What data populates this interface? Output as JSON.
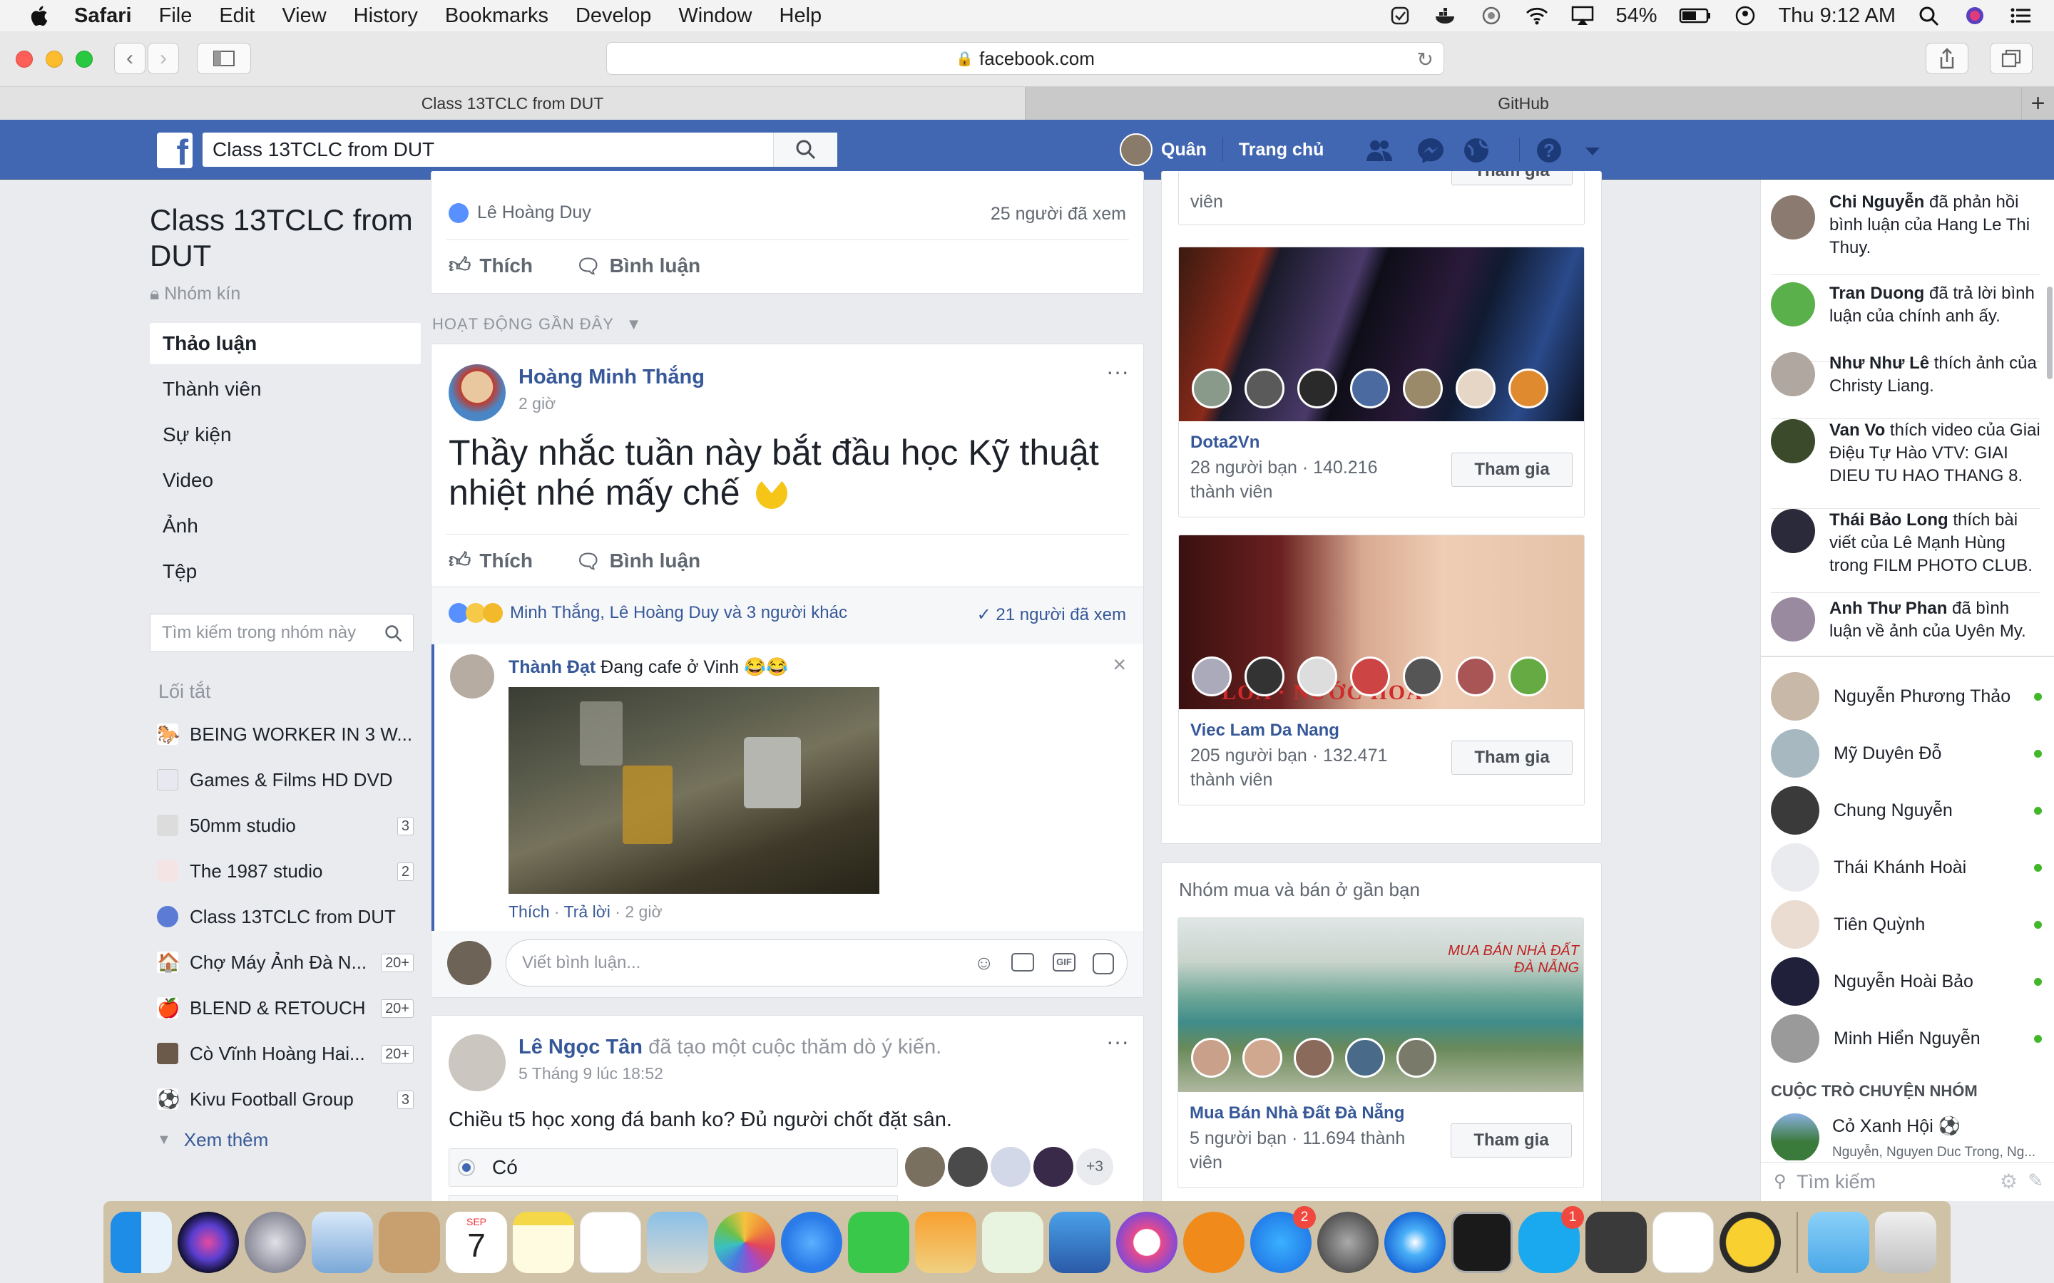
{
  "menubar": {
    "app": "Safari",
    "items": [
      "File",
      "Edit",
      "View",
      "History",
      "Bookmarks",
      "Develop",
      "Window",
      "Help"
    ],
    "battery": "54%",
    "clock": "Thu 9:12 AM"
  },
  "browser": {
    "url": "facebook.com",
    "tabs": [
      "Class 13TCLC from DUT",
      "GitHub"
    ]
  },
  "fbbar": {
    "search_value": "Class 13TCLC from DUT",
    "profile_name": "Quân",
    "home": "Trang chủ"
  },
  "group": {
    "title": "Class 13TCLC from DUT",
    "type": "Nhóm kín",
    "nav": [
      "Thảo luận",
      "Thành viên",
      "Sự kiện",
      "Video",
      "Ảnh",
      "Tệp"
    ],
    "search_placeholder": "Tìm kiếm trong nhóm này",
    "shortcuts_heading": "Lối tắt",
    "shortcuts": [
      {
        "label": "BEING WORKER IN 3 W...",
        "count": ""
      },
      {
        "label": "Games & Films HD DVD",
        "count": ""
      },
      {
        "label": "50mm studio",
        "count": "3"
      },
      {
        "label": "The 1987 studio",
        "count": "2"
      },
      {
        "label": "Class 13TCLC from DUT",
        "count": ""
      },
      {
        "label": "Chợ Máy Ảnh Đà N...",
        "count": "20+"
      },
      {
        "label": "BLEND & RETOUCH",
        "count": "20+"
      },
      {
        "label": "Cò Vĩnh Hoàng Hai...",
        "count": "20+"
      },
      {
        "label": "Kivu Football Group",
        "count": "3"
      }
    ],
    "see_more": "Xem thêm"
  },
  "feed": {
    "top_post": {
      "liker": "Lê Hoàng Duy",
      "seen": "25 người đã xem",
      "like": "Thích",
      "comment": "Bình luận"
    },
    "section_heading": "HOẠT ĐỘNG GẦN ĐÂY",
    "post1": {
      "author": "Hoàng Minh Thắng",
      "time": "2 giờ",
      "text": "Thầy nhắc tuần này bắt đầu học Kỹ thuật nhiệt nhé mấy chế",
      "like": "Thích",
      "comment": "Bình luận",
      "reactors": "Minh Thắng, Lê Hoàng Duy và 3 người khác",
      "seen": "21 người đã xem",
      "reply_author": "Thành Đạt",
      "reply_text": "Đang cafe ở Vinh 😂😂",
      "reply_like": "Thích",
      "reply_reply": "Trả lời",
      "reply_time": "2 giờ",
      "comment_placeholder": "Viết bình luận..."
    },
    "post2": {
      "author": "Lê Ngọc Tân",
      "action": "đã tạo một cuộc thăm dò ý kiến.",
      "time": "5 Tháng 9 lúc 18:52",
      "text": "Chiều t5 học xong đá banh ko? Đủ người chốt đặt sân.",
      "option1": "Có",
      "more_voters": "+3"
    }
  },
  "suggestions": {
    "top_meta": "viên",
    "join": "Tham gia",
    "groups": [
      {
        "name": "Dota2Vn",
        "meta1": "28 người bạn · 140.216",
        "meta2": "thành viên"
      },
      {
        "name": "Viec Lam Da Nang",
        "meta1": "205 người bạn · 132.471",
        "meta2": "thành viên"
      }
    ],
    "nearby_heading": "Nhóm mua và bán ở gần bạn",
    "nearby": {
      "name": "Mua Bán Nhà Đất Đà Nẵng",
      "meta1": "5 người bạn · 11.694 thành",
      "meta2": "viên"
    }
  },
  "chat": {
    "ticker": [
      {
        "name": "Chi Nguyễn",
        "text": "đã phản hồi bình luận của Hang Le Thi Thuy."
      },
      {
        "name": "Tran Duong",
        "text": "đã trả lời bình luận của chính anh ấy."
      },
      {
        "name": "Như Như Lê",
        "text": "thích ảnh của Christy Liang."
      },
      {
        "name": "Van Vo",
        "text": "thích video của Giai Điệu Tự Hào VTV: GIAI DIEU TU HAO THANG 8."
      },
      {
        "name": "Thái Bảo Long",
        "text": "thích bài viết của Lê Mạnh Hùng trong FILM PHOTO CLUB."
      },
      {
        "name": "Anh Thư Phan",
        "text": "đã bình luận về ảnh của Uyên My."
      }
    ],
    "contacts": [
      "Nguyễn Phương Thảo",
      "Mỹ Duyên Đỗ",
      "Chung Nguyễn",
      "Thái Khánh Hoài",
      "Tiên Quỳnh",
      "Nguyễn Hoài Bảo",
      "Minh Hiển Nguyễn"
    ],
    "group_heading": "CUỘC TRÒ CHUYỆN NHÓM",
    "group_chat": {
      "name": "Cỏ Xanh Hội ⚽",
      "members": "Nguyễn, Nguyen Duc Trong, Ng..."
    },
    "search_placeholder": "Tìm kiếm"
  },
  "dock": {
    "calendar_month": "SEP",
    "calendar_day": "7",
    "appstore_badge": "2",
    "skype_badge": "1"
  },
  "colors": {
    "fb_blue": "#4267b2",
    "link": "#365899",
    "online": "#42b72a"
  }
}
